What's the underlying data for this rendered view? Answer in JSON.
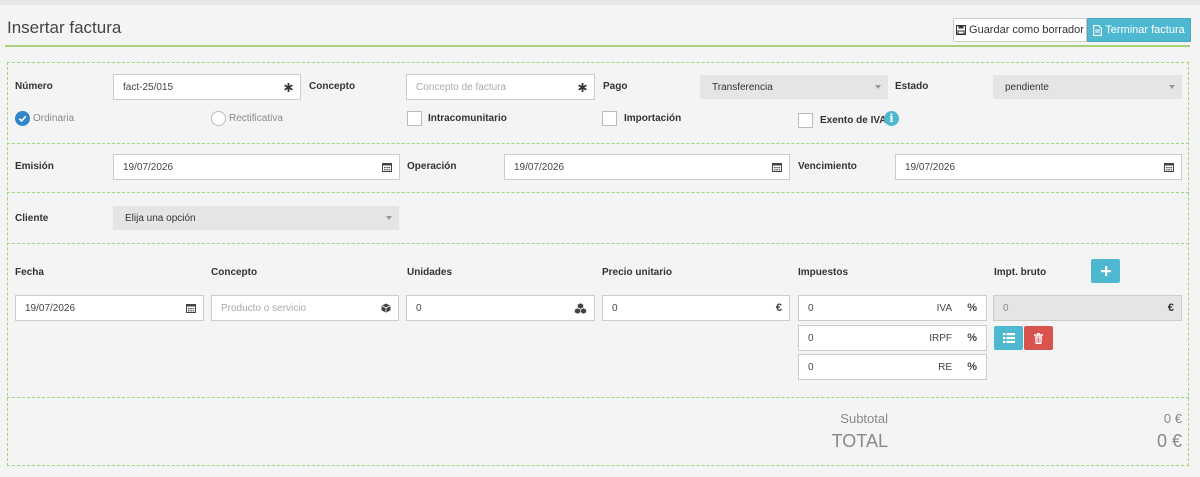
{
  "header": {
    "title": "Insertar factura",
    "draft_label": "Guardar como borrador",
    "finish_label": "Terminar factura"
  },
  "invoice": {
    "numero_label": "Número",
    "numero_value": "fact-25/015",
    "concepto_label": "Concepto",
    "concepto_placeholder": "Concepto de factura",
    "pago_label": "Pago",
    "pago_value": "Transferencia",
    "estado_label": "Estado",
    "estado_value": "pendiente",
    "radios": [
      {
        "label": "Ordinaria",
        "checked": true
      },
      {
        "label": "Rectificativa",
        "checked": false
      }
    ],
    "checkboxes": [
      {
        "label": "Intracomunitario",
        "checked": false
      },
      {
        "label": "Importación",
        "checked": false
      },
      {
        "label": "Exento de IVA",
        "checked": false
      }
    ],
    "info_glyph": "i"
  },
  "dates": {
    "emision_label": "Emisión",
    "emision_value": "19/07/2026",
    "operacion_label": "Operación",
    "operacion_value": "19/07/2026",
    "vencimiento_label": "Vencimiento",
    "vencimiento_value": "19/07/2026"
  },
  "client": {
    "label": "Cliente",
    "value": "Elija una opción"
  },
  "lines": {
    "headers": [
      "Fecha",
      "Concepto",
      "Unidades",
      "Precio unitario",
      "Impuestos",
      "Impt. bruto"
    ],
    "row": {
      "fecha": "19/07/2026",
      "concepto_placeholder": "Producto o servicio",
      "unidades": "0",
      "precio": "0",
      "currency": "€",
      "taxes": [
        {
          "value": "0",
          "name": "IVA",
          "unit": "%"
        },
        {
          "value": "0",
          "name": "IRPF",
          "unit": "%"
        },
        {
          "value": "0",
          "name": "RE",
          "unit": "%"
        }
      ],
      "bruto": "0"
    }
  },
  "totals": {
    "subtotal_label": "Subtotal",
    "subtotal_value": "0 €",
    "total_label": "TOTAL",
    "total_value": "0 €"
  },
  "icons": [
    "save-icon",
    "file-icon",
    "asterisk-icon",
    "calendar-icon",
    "cube-icon",
    "cubes-icon",
    "plus-icon",
    "list-icon",
    "trash-icon",
    "info-icon",
    "check-icon"
  ],
  "colors": {
    "accent": "#4fb8d1",
    "danger": "#d9534f",
    "radio_on": "#2f86c9",
    "dashed_border": "#9ed67a"
  }
}
